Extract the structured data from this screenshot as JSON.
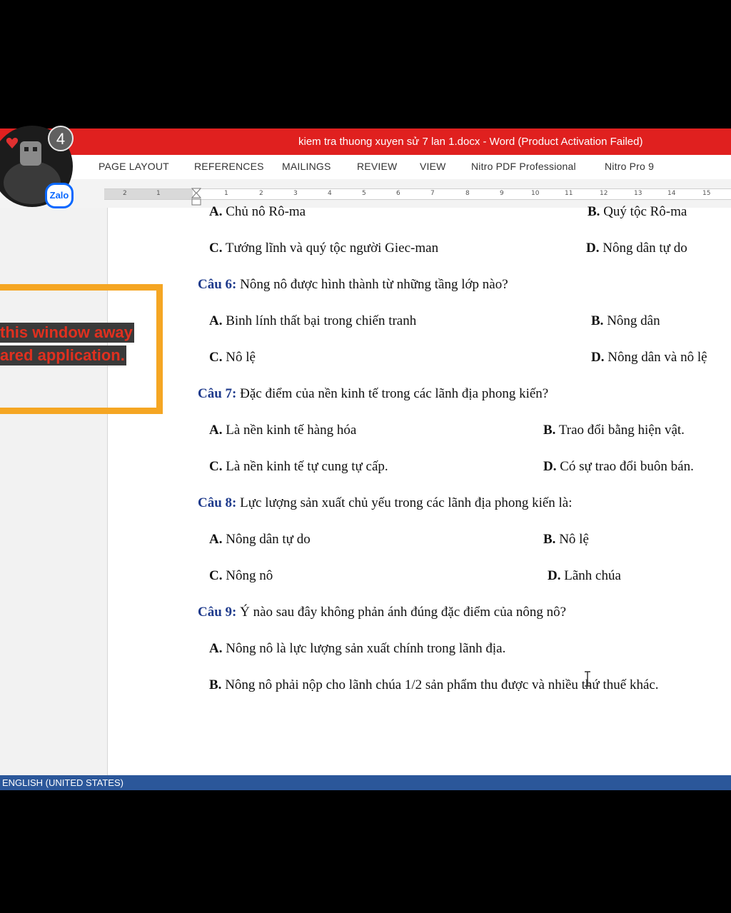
{
  "window": {
    "title": "kiem tra thuong xuyen sử 7 lan 1.docx -  Word (Product Activation Failed)"
  },
  "ribbon_tabs": [
    "PAGE LAYOUT",
    "REFERENCES",
    "MAILINGS",
    "REVIEW",
    "VIEW",
    "Nitro PDF Professional",
    "Nitro Pro 9"
  ],
  "ruler_labels": [
    "2",
    "1",
    "1",
    "2",
    "3",
    "4",
    "5",
    "6",
    "7",
    "8",
    "9",
    "10",
    "11",
    "12",
    "13",
    "14",
    "15"
  ],
  "notification": {
    "count": "4",
    "app": "Zalo"
  },
  "overlay": {
    "line1": "this window away",
    "line2": "ared application."
  },
  "document": [
    {
      "type": "options",
      "a": {
        "label": "A.",
        "text": " Chủ nô Rô-ma"
      },
      "b": {
        "label": "B.",
        "text": " Quý tộc Rô-ma"
      }
    },
    {
      "type": "options",
      "a": {
        "label": "C.",
        "text": " Tướng lĩnh và quý tộc người Giec-man"
      },
      "b": {
        "label": "D.",
        "text": " Nông dân tự do"
      }
    },
    {
      "type": "question",
      "label": "Câu 6:",
      "text": " Nông nô được hình thành từ những tầng lớp nào?"
    },
    {
      "type": "options",
      "a": {
        "label": "A.",
        "text": " Binh lính thất bại trong chiến tranh"
      },
      "b": {
        "label": "B.",
        "text": " Nông dân"
      }
    },
    {
      "type": "options",
      "a": {
        "label": "C.",
        "text": " Nô lệ"
      },
      "b": {
        "label": "D.",
        "text": " Nông dân và nô lệ"
      }
    },
    {
      "type": "question",
      "label": "Câu 7:",
      "text": " Đặc điểm của nền kinh tế trong các lãnh địa phong kiến?"
    },
    {
      "type": "options",
      "a": {
        "label": "A.",
        "text": " Là nền kinh tế hàng hóa"
      },
      "b": {
        "label": "B.",
        "text": " Trao đổi bằng hiện vật."
      }
    },
    {
      "type": "options",
      "a": {
        "label": "C.",
        "text": " Là nền kinh tế tự cung tự cấp."
      },
      "b": {
        "label": "D.",
        "text": " Có sự trao đổi buôn bán."
      }
    },
    {
      "type": "question",
      "label": "Câu 8:",
      "text": " Lực lượng sản xuất chủ yếu trong các lãnh địa phong kiến là:"
    },
    {
      "type": "options",
      "a": {
        "label": "A.",
        "text": " Nông dân tự do"
      },
      "b": {
        "label": "B.",
        "text": " Nô lệ"
      }
    },
    {
      "type": "options",
      "a": {
        "label": "C.",
        "text": " Nông nô"
      },
      "b": {
        "label": "D.",
        "text": " Lãnh chúa"
      }
    },
    {
      "type": "question",
      "label": "Câu 9:",
      "text": " Ý nào sau đây không phản ánh đúng đặc điểm của nông nô?"
    },
    {
      "type": "single",
      "label": "A.",
      "text": " Nông nô là lực lượng sản xuất chính trong lãnh địa."
    },
    {
      "type": "single",
      "label": "B.",
      "text": " Nông nô phải nộp cho lãnh chúa 1/2 sản phẩm thu được và nhiều thứ thuế khác."
    }
  ],
  "statusbar": {
    "language": "ENGLISH (UNITED STATES)"
  },
  "colors": {
    "titlebar": "#e0201f",
    "statusbar": "#2b579a",
    "question_label": "#1f3b8c",
    "overlay_border": "#f5a623"
  }
}
